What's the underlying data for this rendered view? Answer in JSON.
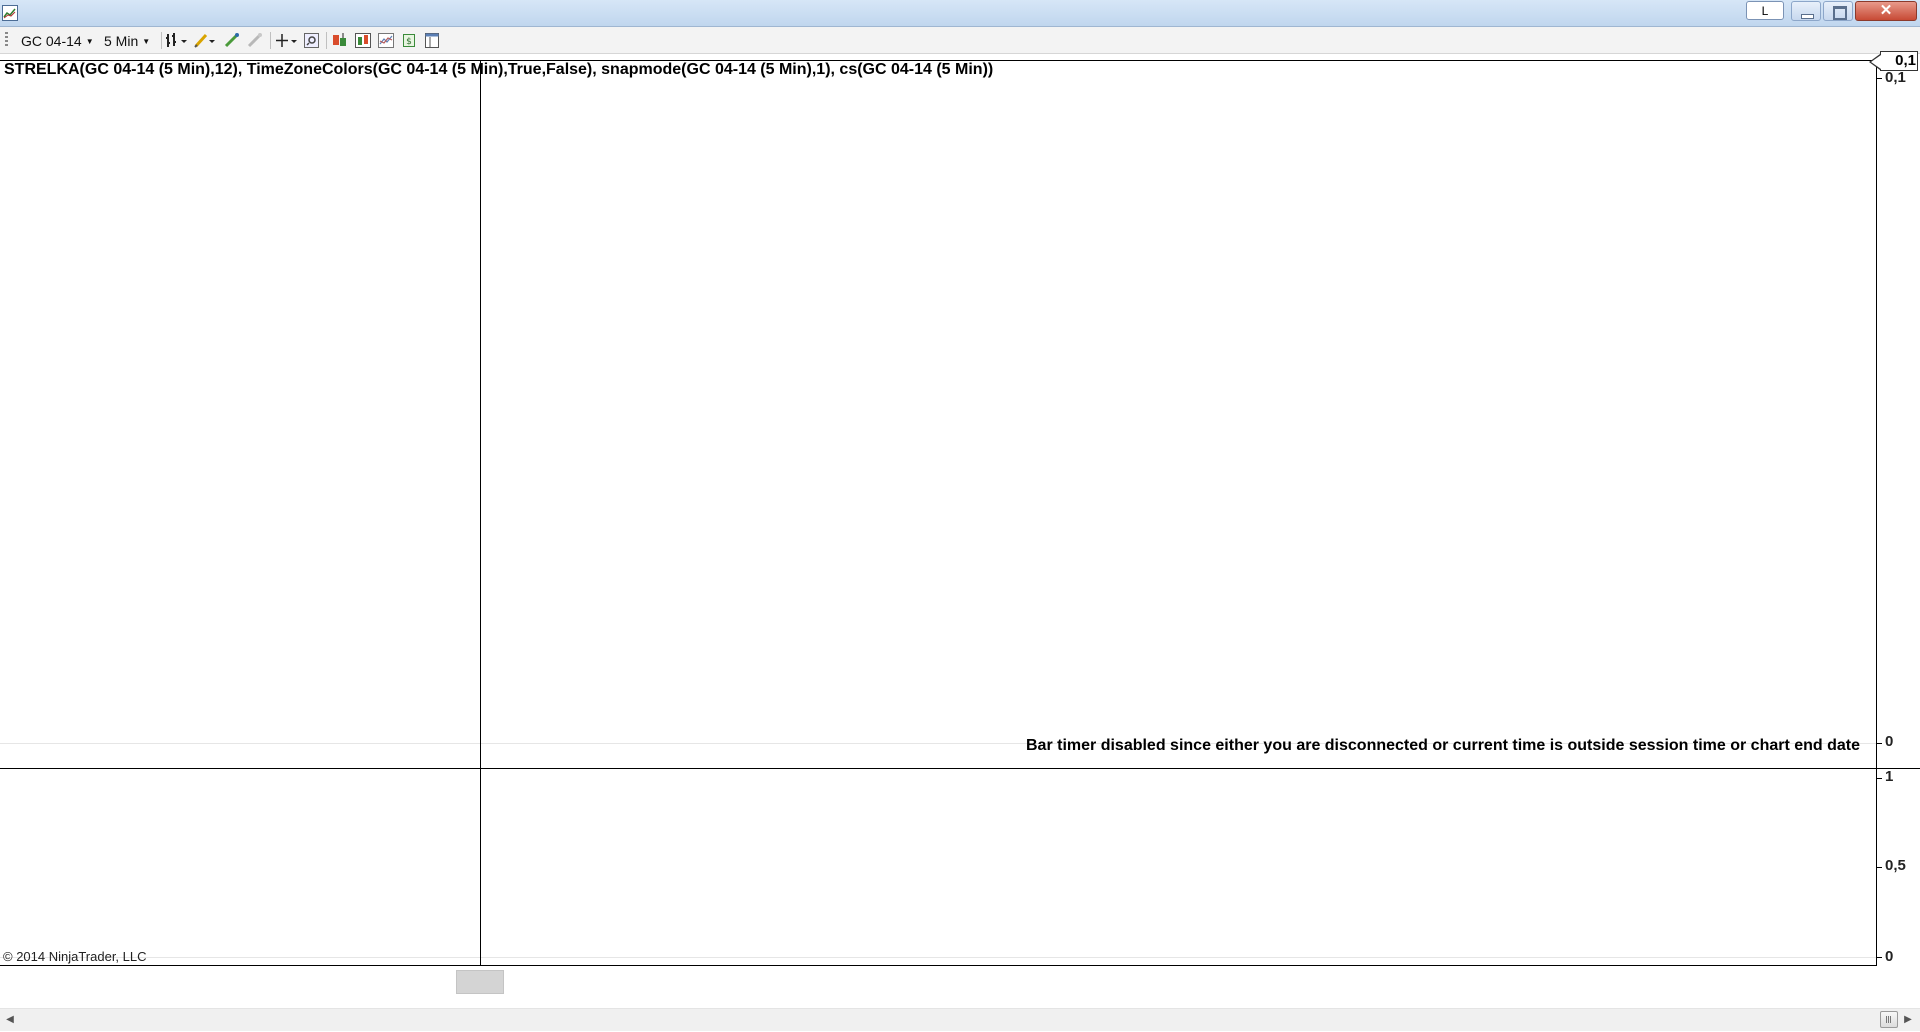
{
  "window": {
    "layout_button_label": "L",
    "close_glyph": "✕"
  },
  "toolbar": {
    "instrument": "GC 04-14",
    "interval": "5 Min",
    "icons": [
      "chart-style-icon",
      "drawing-tools-icon",
      "pencil-icon",
      "eraser-icon",
      "crosshair-icon",
      "zoom-icon",
      "add-instrument-icon",
      "data-series-icon",
      "indicators-icon",
      "strategy-icon",
      "properties-icon"
    ]
  },
  "chart": {
    "indicator_label": "STRELKA(GC 04-14 (5 Min),12), TimeZoneColors(GC 04-14 (5 Min),True,False), snapmode(GC 04-14 (5 Min),1), cs(GC 04-14 (5 Min))",
    "price_flag": "0,1",
    "upper_axis": [
      "0,1",
      "0"
    ],
    "lower_axis": [
      "1",
      "0,5",
      "0"
    ],
    "bar_timer_message": "Bar timer disabled since either you are disconnected or current time is outside session time or chart end date",
    "copyright": "© 2014 NinjaTrader, LLC"
  },
  "scrollbar": {
    "left_arrow": "◀",
    "right_arrow": "▶"
  }
}
